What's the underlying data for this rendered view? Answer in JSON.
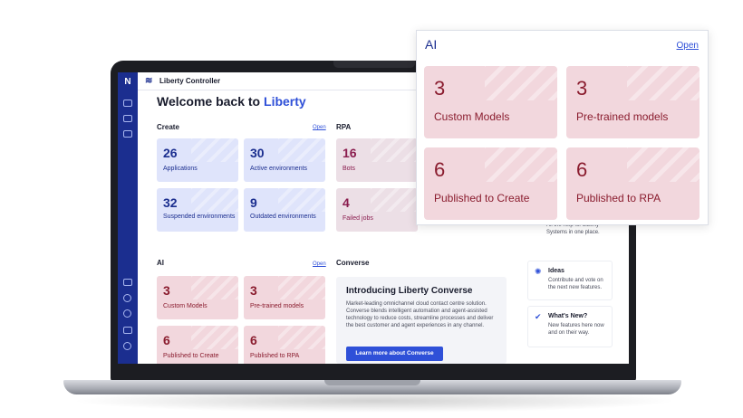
{
  "app": {
    "name": "Liberty Controller"
  },
  "welcome": {
    "prefix": "Welcome back to",
    "highlight": "Liberty"
  },
  "sections": {
    "create": {
      "title": "Create",
      "link": "Open"
    },
    "rpa": {
      "title": "RPA"
    },
    "ai": {
      "title": "AI",
      "link": "Open"
    },
    "converse": {
      "title": "Converse"
    }
  },
  "create_tiles": [
    {
      "value": "26",
      "label": "Applications"
    },
    {
      "value": "30",
      "label": "Active environments"
    },
    {
      "value": "32",
      "label": "Suspended environments"
    },
    {
      "value": "9",
      "label": "Outdated environments"
    }
  ],
  "rpa_tiles": [
    {
      "value": "16",
      "label": "Bots"
    },
    {
      "value": "4",
      "label": "Failed jobs"
    }
  ],
  "ai_tiles": [
    {
      "value": "3",
      "label": "Custom Models"
    },
    {
      "value": "3",
      "label": "Pre-trained models"
    },
    {
      "value": "6",
      "label": "Published to Create"
    },
    {
      "value": "6",
      "label": "Published to RPA"
    }
  ],
  "converse": {
    "heading": "Introducing Liberty Converse",
    "body": "Market-leading omnichannel cloud contact centre solution. Converse blends intelligent automation and agent-assisted technology to reduce costs, streamline processes and deliver the best customer and agent experiences in any channel.",
    "button": "Learn more about Converse"
  },
  "help": {
    "partial_text": "All the help for Liberty Systems in one place.",
    "ideas": {
      "title": "Ideas",
      "text": "Contribute and vote on the next new features."
    },
    "whats_new": {
      "title": "What's New?",
      "text": "New features here now and on their way."
    }
  },
  "popup": {
    "title": "AI",
    "link": "Open",
    "tiles": [
      {
        "value": "3",
        "label": "Custom Models"
      },
      {
        "value": "3",
        "label": "Pre-trained models"
      },
      {
        "value": "6",
        "label": "Published to Create"
      },
      {
        "value": "6",
        "label": "Published to RPA"
      }
    ]
  },
  "icons": {
    "logo": "liberty-logo-icon",
    "ideas": "lightbulb-icon",
    "whats_new": "check-circle-icon"
  },
  "colors": {
    "sidebar": "#1b2e8f",
    "accent": "#2f50d8",
    "create_tile": "#dfe4fb",
    "ai_tile": "#f2d7dd",
    "rpa_tile": "#ecdfe6"
  }
}
